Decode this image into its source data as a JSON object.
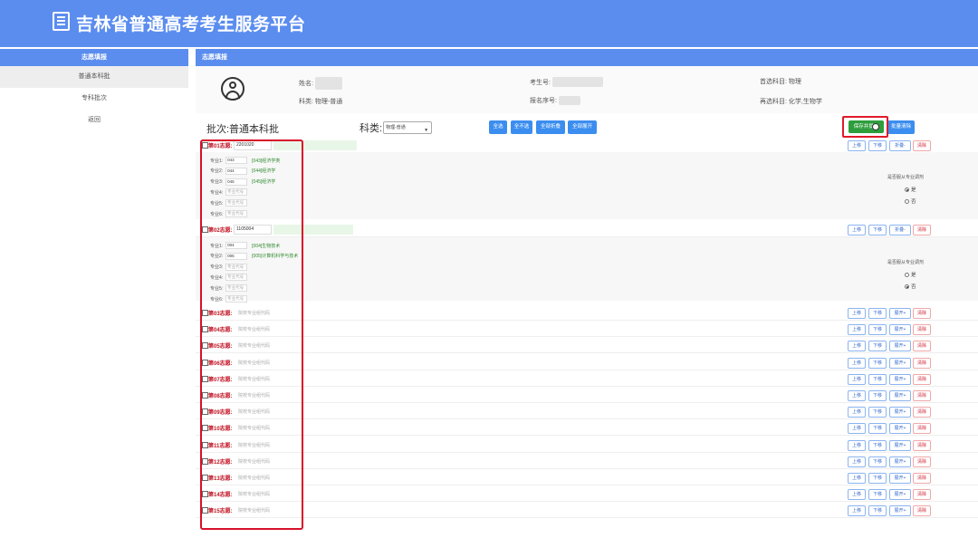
{
  "header": {
    "title": "吉林省普通高考考生服务平台"
  },
  "sidebar": {
    "title": "志愿填报",
    "items": [
      {
        "label": "普通本科批"
      },
      {
        "label": "专科批次"
      },
      {
        "label": "返回"
      }
    ]
  },
  "main": {
    "title": "志愿填报",
    "info": {
      "name_label": "姓名:",
      "subject_type": "科类: 物理-普通",
      "exam_no_label": "考生号:",
      "reg_no_label": "报名序号:",
      "first_choice": "首选科目: 物理",
      "second_choice": "再选科目: 化学,生物学"
    },
    "toolbar": {
      "batch": "批次:普通本科批",
      "subject_label": "科类:",
      "subject_value": "物理-普通",
      "buttons": [
        "全选",
        "全不选",
        "全部折叠",
        "全部展开"
      ],
      "save": "保存并提交",
      "batch_clear": "批量清除"
    },
    "labels": {
      "up": "上移",
      "down": "下移",
      "fold": "折叠-",
      "expand": "展开+",
      "clear": "清除",
      "adjust": "是否服从专业调剂",
      "yes": "是",
      "no": "否",
      "placeholder": "院校专业组代码",
      "major_placeholder": "专业代号"
    },
    "wishes": [
      {
        "label": "第01志愿:",
        "code": "2201020",
        "majors": [
          {
            "label": "专业1:",
            "code": "043",
            "name": "[043]经济学类"
          },
          {
            "label": "专业2:",
            "code": "044",
            "name": "[044]经济学"
          },
          {
            "label": "专业3:",
            "code": "045",
            "name": "[045]经济学"
          },
          {
            "label": "专业4:",
            "code": "",
            "name": ""
          },
          {
            "label": "专业5:",
            "code": "",
            "name": ""
          },
          {
            "label": "专业6:",
            "code": "",
            "name": ""
          }
        ],
        "adjust": "是"
      },
      {
        "label": "第02志愿:",
        "code": "1105004",
        "majors": [
          {
            "label": "专业1:",
            "code": "004",
            "name": "[004]生物技术"
          },
          {
            "label": "专业2:",
            "code": "005",
            "name": "[005]计算机科学与技术"
          },
          {
            "label": "专业3:",
            "code": "",
            "name": ""
          },
          {
            "label": "专业4:",
            "code": "",
            "name": ""
          },
          {
            "label": "专业5:",
            "code": "",
            "name": ""
          },
          {
            "label": "专业6:",
            "code": "",
            "name": ""
          }
        ],
        "adjust": "否"
      },
      {
        "label": "第03志愿:"
      },
      {
        "label": "第04志愿:"
      },
      {
        "label": "第05志愿:"
      },
      {
        "label": "第06志愿:"
      },
      {
        "label": "第07志愿:"
      },
      {
        "label": "第08志愿:"
      },
      {
        "label": "第09志愿:"
      },
      {
        "label": "第10志愿:"
      },
      {
        "label": "第11志愿:"
      },
      {
        "label": "第12志愿:"
      },
      {
        "label": "第13志愿:"
      },
      {
        "label": "第14志愿:"
      },
      {
        "label": "第15志愿:"
      }
    ]
  }
}
